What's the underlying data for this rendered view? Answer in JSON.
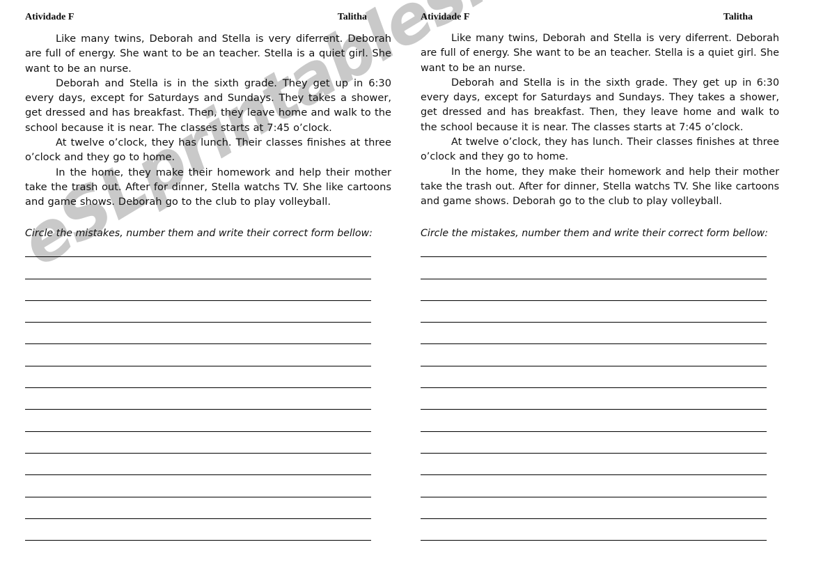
{
  "document": {
    "title": "Atividade F",
    "author": "Talitha",
    "watermark": "eSLprintables.com",
    "watermark_color": "#c9c9c9",
    "page_background": "#ffffff",
    "text_color": "#111111",
    "rule_color": "#000000"
  },
  "worksheet": {
    "header": {
      "left_label": "Atividade F",
      "right_label": "Talitha"
    },
    "paragraphs": [
      "Like many twins, Deborah and Stella is very diferrent. Deborah are full of energy. She want to be an teacher. Stella is a quiet girl. She want to be an nurse.",
      "Deborah and Stella is in the sixth grade. They get up in 6:30 every days, except for Saturdays and Sundays. They takes a shower, get dressed and has breakfast. Then, they leave home and walk to the school because it is near. The classes starts at 7:45 o’clock.",
      "At twelve o’clock, they has lunch. Their classes finishes at three o’clock and they go to home.",
      "In the home, they make their homework and help their mother take the trash out. After for dinner, Stella watchs TV. She like cartoons and game shows. Deborah go to the club to play volleyball."
    ],
    "instruction": "Circle the mistakes, number them and write their correct form bellow:",
    "answer_line_count": 14
  },
  "columns": [
    {
      "id": "left",
      "position": "left"
    },
    {
      "id": "right",
      "position": "right"
    }
  ]
}
